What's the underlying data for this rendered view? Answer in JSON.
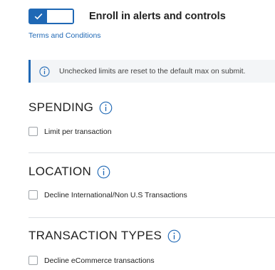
{
  "enroll": {
    "label": "Enroll in alerts and controls",
    "enabled": true
  },
  "terms_link": "Terms and Conditions",
  "info_banner": {
    "text": "Unchecked limits are reset to the default max on submit."
  },
  "sections": [
    {
      "title": "SPENDING",
      "options": [
        {
          "label": "Limit per transaction",
          "checked": false
        }
      ]
    },
    {
      "title": "LOCATION",
      "options": [
        {
          "label": "Decline International/Non U.S Transactions",
          "checked": false
        }
      ]
    },
    {
      "title": "TRANSACTION TYPES",
      "options": [
        {
          "label": "Decline eCommerce transactions",
          "checked": false
        }
      ]
    }
  ],
  "colors": {
    "accent": "#1f68b5",
    "banner_bg": "#f3f5f7",
    "divider": "#dcdfe3"
  }
}
